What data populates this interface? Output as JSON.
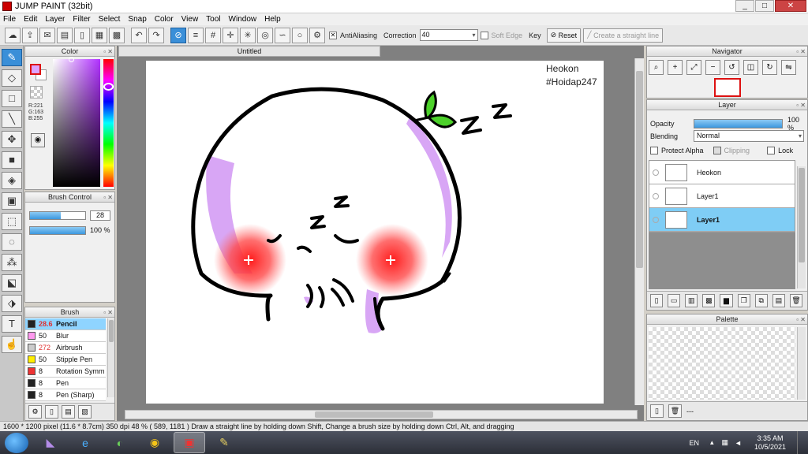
{
  "window": {
    "title": "JUMP PAINT (32bit)",
    "minimize": "_",
    "maximize": "□",
    "close": "✕"
  },
  "menu": [
    "File",
    "Edit",
    "Layer",
    "Filter",
    "Select",
    "Snap",
    "Color",
    "View",
    "Tool",
    "Window",
    "Help"
  ],
  "toolbar": {
    "antialiasing_label": "AntiAliasing",
    "correction_label": "Correction",
    "correction_value": "40",
    "soft_edge_label": "Soft Edge",
    "key_label": "Key",
    "reset_label": "Reset",
    "straight_line_label": "Create a straight line"
  },
  "color_panel": {
    "title": "Color",
    "r": "R:221",
    "g": "G:163",
    "b": "B:255",
    "fg_color": "#dda3ff"
  },
  "brush_control": {
    "title": "Brush Control",
    "size_value": "28",
    "opacity_value": "100 %",
    "size_fraction": 0.56,
    "opacity_fraction": 1.0
  },
  "brush_panel": {
    "title": "Brush",
    "items": [
      {
        "size": "28.6",
        "name": "Pencil",
        "color": "#222222",
        "red": true,
        "selected": true
      },
      {
        "size": "50",
        "name": "Blur",
        "color": "#ff99ee",
        "red": false,
        "selected": false
      },
      {
        "size": "272",
        "name": "Airbrush",
        "color": "#cccccc",
        "red": true,
        "selected": false
      },
      {
        "size": "50",
        "name": "Stipple Pen",
        "color": "#ffee00",
        "red": false,
        "selected": false
      },
      {
        "size": "8",
        "name": "Rotation Symm",
        "color": "#ee3333",
        "red": false,
        "selected": false
      },
      {
        "size": "8",
        "name": "Pen",
        "color": "#222222",
        "red": false,
        "selected": false
      },
      {
        "size": "8",
        "name": "Pen (Sharp)",
        "color": "#222222",
        "red": false,
        "selected": false
      }
    ]
  },
  "document": {
    "tab": "Untitled",
    "watermark_line1": "Heokon",
    "watermark_line2": "#Hoidap247"
  },
  "navigator": {
    "title": "Navigator"
  },
  "layer_panel": {
    "title": "Layer",
    "opacity_label": "Opacity",
    "opacity_value": "100 %",
    "blending_label": "Blending",
    "blending_value": "Normal",
    "protect_alpha_label": "Protect Alpha",
    "clipping_label": "Clipping",
    "lock_label": "Lock",
    "layers": [
      {
        "name": "Heokon",
        "selected": false
      },
      {
        "name": "Layer1",
        "selected": false
      },
      {
        "name": "Layer1",
        "selected": true
      }
    ]
  },
  "palette_panel": {
    "title": "Palette",
    "footer_text": "---"
  },
  "status": "1600 * 1200 pixel  (11.6 * 8.7cm)  350 dpi  48 %  ( 589, 1181 )  Draw a straight line by holding down Shift, Change a brush size by holding down Ctrl, Alt, and dragging",
  "taskbar": {
    "lang": "EN",
    "time": "3:35 AM",
    "date": "10/5/2021"
  }
}
